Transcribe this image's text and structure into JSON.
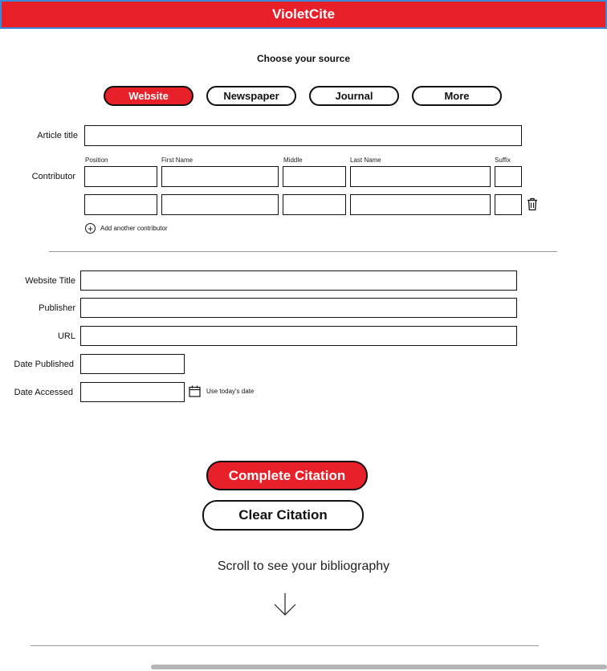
{
  "app": {
    "title": "VioletCite"
  },
  "source": {
    "heading": "Choose your source",
    "tabs": [
      {
        "label": "Website",
        "active": true
      },
      {
        "label": "Newspaper",
        "active": false
      },
      {
        "label": "Journal",
        "active": false
      },
      {
        "label": "More",
        "active": false
      }
    ]
  },
  "article": {
    "title_label": "Article title",
    "title_value": ""
  },
  "contributor": {
    "label": "Contributor",
    "columns": [
      "Position",
      "First Name",
      "Middle",
      "Last Name",
      "Suffix"
    ],
    "rows": [
      {
        "position": "",
        "first": "",
        "middle": "",
        "last": "",
        "suffix": ""
      },
      {
        "position": "",
        "first": "",
        "middle": "",
        "last": "",
        "suffix": ""
      }
    ],
    "add_label": "Add another contributor"
  },
  "website": {
    "title_label": "Website Title",
    "publisher_label": "Publisher",
    "url_label": "URL",
    "date_published_label": "Date Published",
    "date_accessed_label": "Date Accessed",
    "today_label": "Use today's date"
  },
  "actions": {
    "complete_label": "Complete Citation",
    "clear_label": "Clear Citation"
  },
  "footer": {
    "scroll_hint": "Scroll to see your bibliography"
  },
  "colors": {
    "accent": "#e8202a",
    "header_border": "#3b8ad9"
  },
  "icons": [
    "trash-icon",
    "plus-circle-icon",
    "calendar-icon",
    "arrow-down-icon"
  ]
}
